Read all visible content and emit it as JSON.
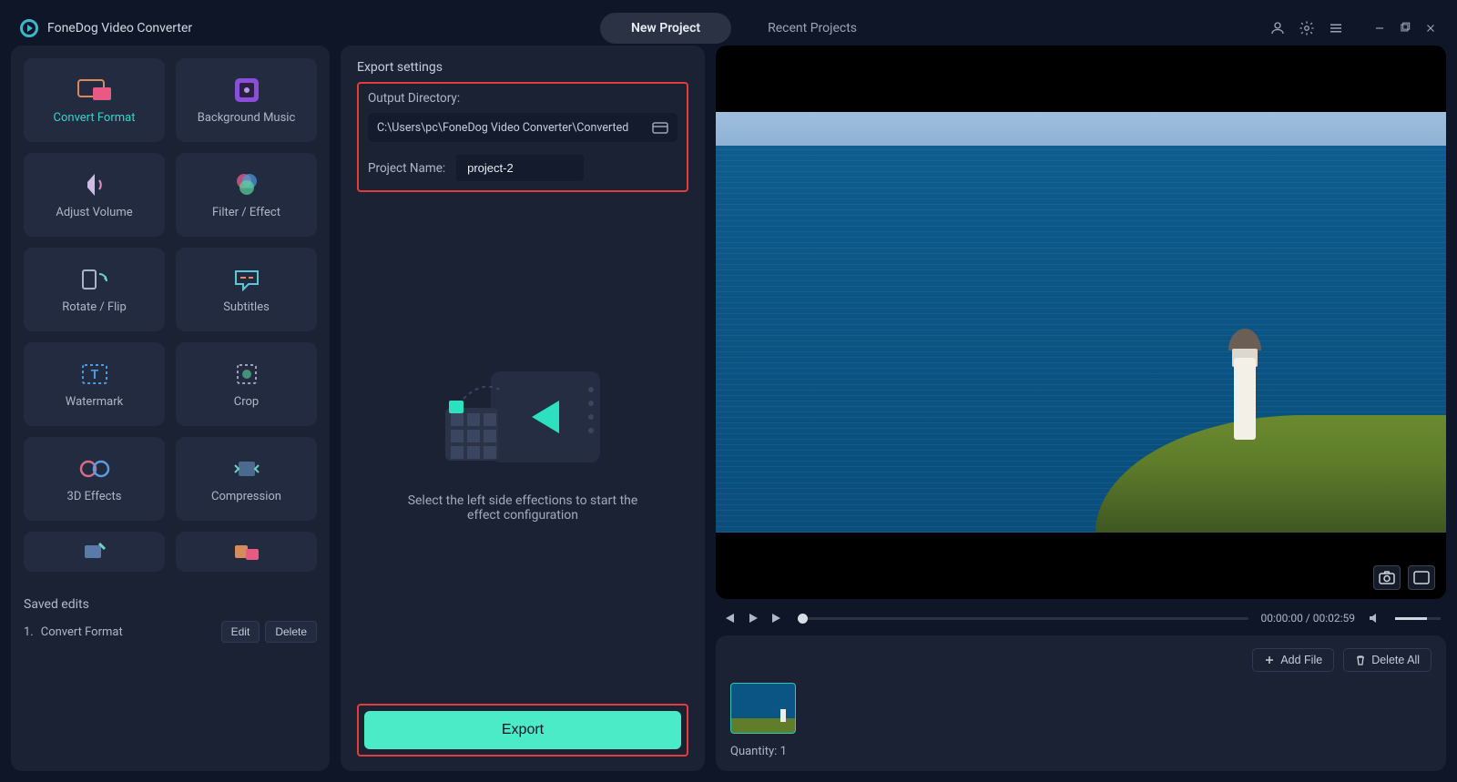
{
  "app_title": "FoneDog Video Converter",
  "tabs": {
    "new_project": "New Project",
    "recent_projects": "Recent Projects"
  },
  "tools": {
    "convert_format": "Convert Format",
    "background_music": "Background Music",
    "adjust_volume": "Adjust Volume",
    "filter_effect": "Filter / Effect",
    "rotate_flip": "Rotate / Flip",
    "subtitles": "Subtitles",
    "watermark": "Watermark",
    "crop": "Crop",
    "3d_effects": "3D Effects",
    "compression": "Compression"
  },
  "saved_edits": {
    "title": "Saved edits",
    "items": [
      {
        "index": "1.",
        "label": "Convert Format"
      }
    ],
    "edit_label": "Edit",
    "delete_label": "Delete"
  },
  "export_settings": {
    "title": "Export settings",
    "output_dir_label": "Output Directory:",
    "output_dir_value": "C:\\Users\\pc\\FoneDog Video Converter\\Converted",
    "project_name_label": "Project Name:",
    "project_name_value": "project-2",
    "placeholder_text": "Select the left side effections to start the effect configuration",
    "export_button": "Export"
  },
  "player": {
    "time_current": "00:00:00",
    "time_separator": " / ",
    "time_total": "00:02:59"
  },
  "tray": {
    "add_file": "Add File",
    "delete_all": "Delete All",
    "quantity_label": "Quantity: ",
    "quantity_value": "1"
  }
}
